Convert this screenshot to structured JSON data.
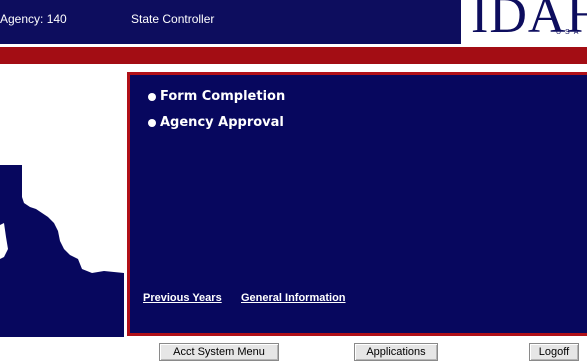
{
  "header": {
    "agency": "Agency: 140",
    "title": "State Controller",
    "logo_text": "IDAHO",
    "logo_subtext": "USA"
  },
  "panel": {
    "items": [
      {
        "label": "Form Completion"
      },
      {
        "label": "Agency Approval"
      }
    ],
    "links": [
      {
        "label": "Previous Years"
      },
      {
        "label": "General Information"
      }
    ]
  },
  "buttons": {
    "acct_system_menu": "Acct System Menu",
    "applications": "Applications",
    "logoff": "Logoff"
  },
  "colors": {
    "header_bg": "#0d0d5e",
    "panel_bg": "#07075e",
    "accent_red": "#a30d14"
  }
}
